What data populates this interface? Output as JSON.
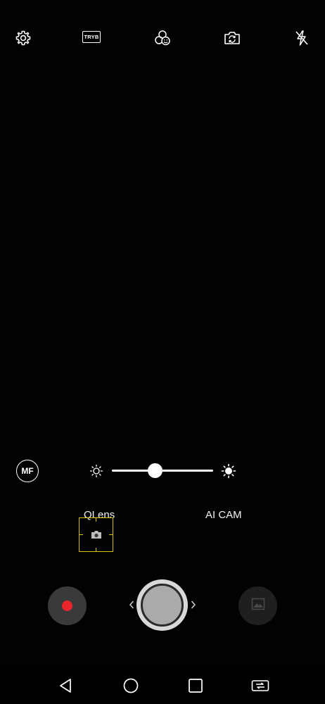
{
  "top_toolbar": {
    "icons": [
      "settings-icon",
      "mode-icon",
      "filter-icon",
      "switch-camera-icon",
      "flash-off-icon"
    ],
    "mode_label": "TRYB"
  },
  "manual_focus": {
    "label": "MF"
  },
  "exposure": {
    "level": 0.43,
    "icons": [
      "brightness-low-icon",
      "brightness-high-icon"
    ]
  },
  "modes": {
    "left": "QLens",
    "right": "AI CAM"
  },
  "focus_frame": {
    "color": "#d8c40c",
    "icon": "camera-icon"
  },
  "controls": {
    "record_color": "#e8262b",
    "shutter_color": "#aaaaaa",
    "icons": [
      "record-icon",
      "shutter-icon",
      "gallery-icon",
      "chevron-left-icon",
      "chevron-right-icon"
    ]
  },
  "navigation": {
    "icons": [
      "back-icon",
      "home-icon",
      "recents-icon",
      "rotate-screen-icon"
    ]
  }
}
